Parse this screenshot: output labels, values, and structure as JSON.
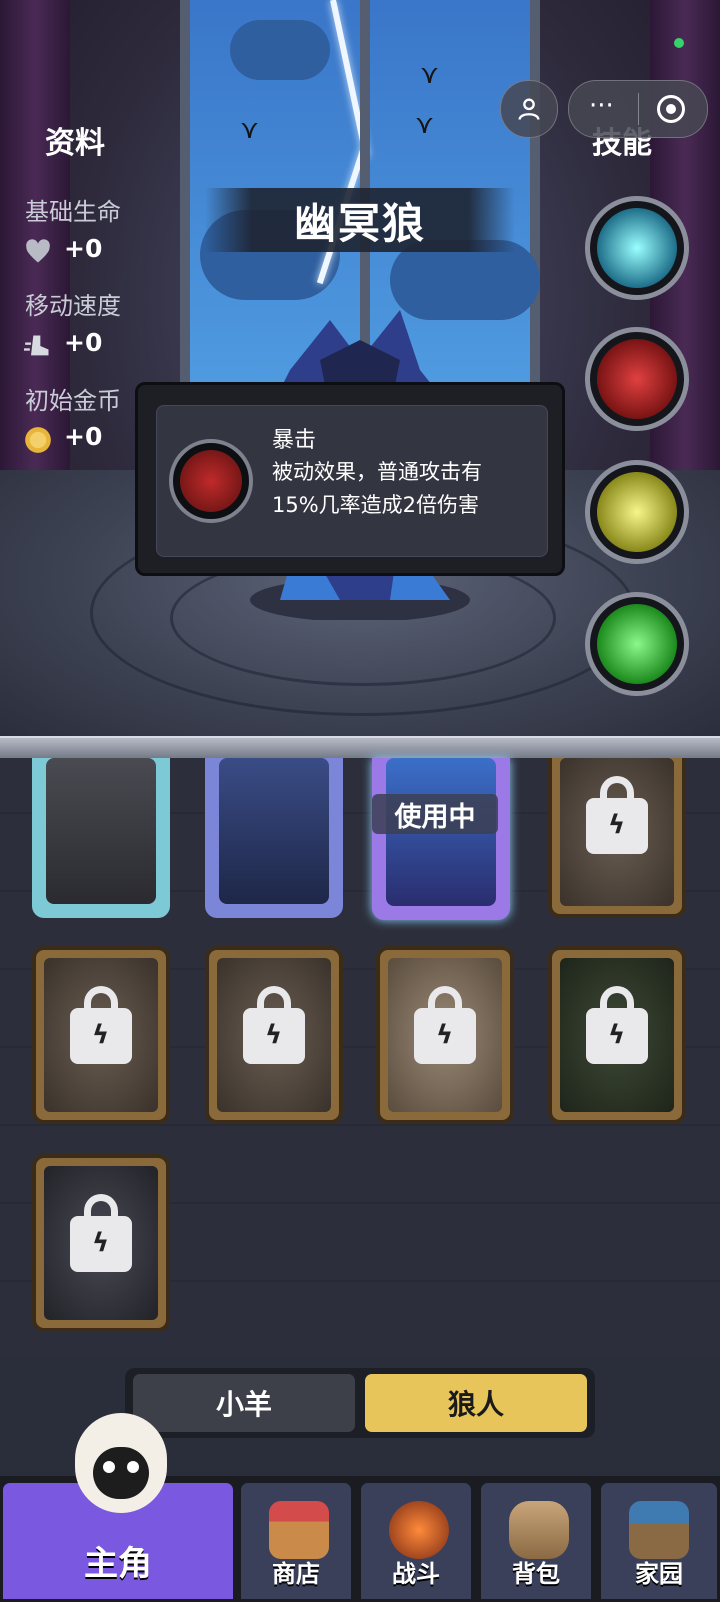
{
  "hero": {
    "name": "幽冥狼",
    "info_title": "资料",
    "skills_title": "技能",
    "stats": [
      {
        "label": "基础生命",
        "value": "+0",
        "icon": "heart-icon"
      },
      {
        "label": "移动速度",
        "value": "+0",
        "icon": "boot-icon"
      },
      {
        "label": "初始金币",
        "value": "+0",
        "icon": "coin-icon"
      }
    ],
    "skills": [
      {
        "icon": "shield-icon",
        "color": "#3fd3d8"
      },
      {
        "icon": "crossed-swords-icon",
        "color": "#c42a2a"
      },
      {
        "icon": "lightning-figure-icon",
        "color": "#d8d83a"
      },
      {
        "icon": "green-aura-icon",
        "color": "#3ac23a"
      }
    ]
  },
  "tooltip": {
    "title": "暴击",
    "description": "被动效果，普通攻击有15%几率造成2倍伤害"
  },
  "cards": {
    "in_use_label": "使用中",
    "items": [
      {
        "state": "owned",
        "frame": "#7ec9d6"
      },
      {
        "state": "owned",
        "frame": "#7c86d8"
      },
      {
        "state": "owned-in-use",
        "frame": "#9b79e6"
      },
      {
        "state": "locked"
      },
      {
        "state": "locked"
      },
      {
        "state": "locked"
      },
      {
        "state": "locked"
      },
      {
        "state": "locked"
      },
      {
        "state": "locked"
      }
    ]
  },
  "toggle": {
    "options": [
      "小羊",
      "狼人"
    ],
    "selected": "狼人"
  },
  "nav": {
    "tabs": [
      {
        "label": "主角",
        "icon": "sheep-icon",
        "active": true
      },
      {
        "label": "商店",
        "icon": "shop-icon",
        "active": false
      },
      {
        "label": "战斗",
        "icon": "battle-icon",
        "active": false
      },
      {
        "label": "背包",
        "icon": "backpack-icon",
        "active": false
      },
      {
        "label": "家园",
        "icon": "home-icon",
        "active": false
      }
    ]
  }
}
